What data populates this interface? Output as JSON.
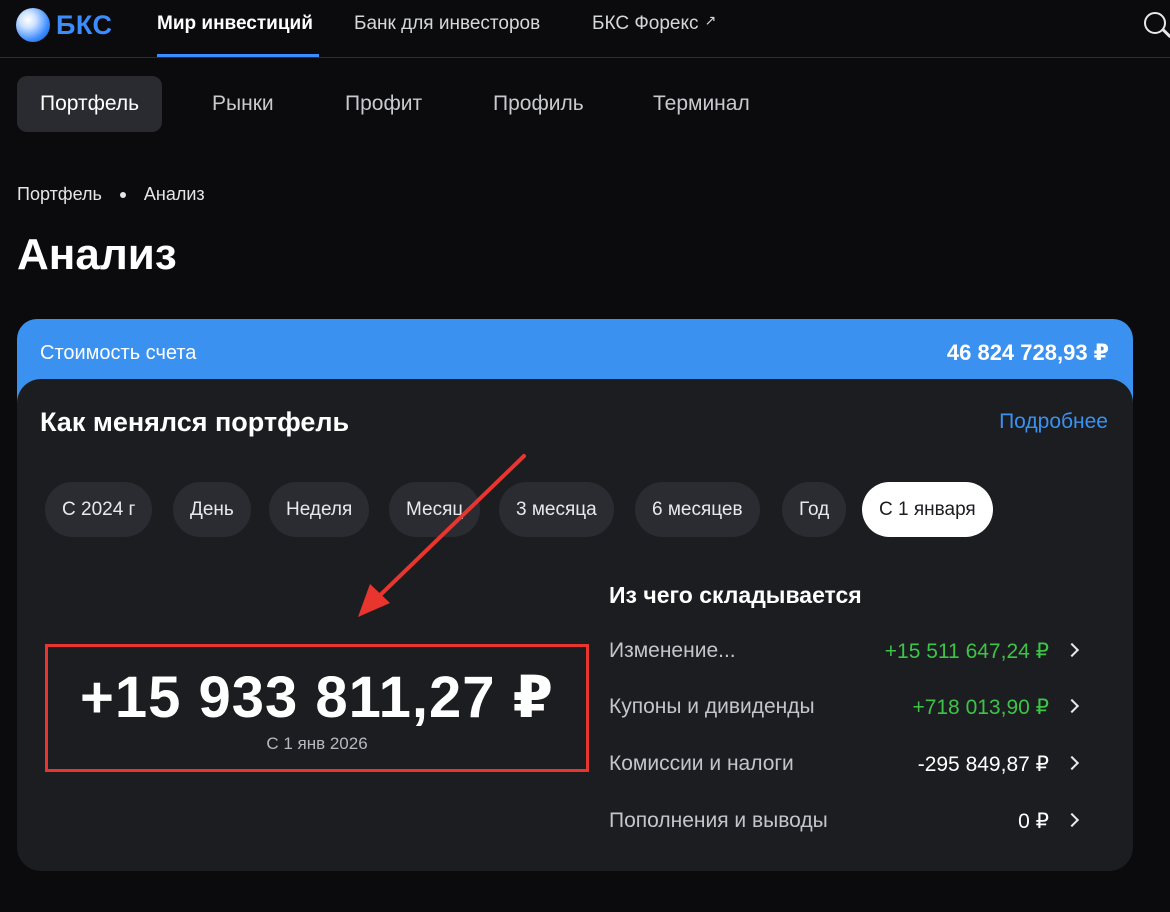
{
  "header": {
    "logo_text": "БКС",
    "nav": [
      "Мир инвестиций",
      "Банк для инвесторов",
      "БКС Форекс"
    ],
    "external_icon": "↗"
  },
  "tabs": [
    "Портфель",
    "Рынки",
    "Профит",
    "Профиль",
    "Терминал"
  ],
  "breadcrumb": [
    "Портфель",
    "Анализ"
  ],
  "page_title": "Анализ",
  "account": {
    "label": "Стоимость счета",
    "value": "46 824 728,93 ₽"
  },
  "panel": {
    "title": "Как менялся портфель",
    "more_link": "Подробнее",
    "periods": [
      "С 2024 г",
      "День",
      "Неделя",
      "Месяц",
      "3 месяца",
      "6 месяцев",
      "Год",
      "С 1 января"
    ],
    "selected_period": "С 1 января",
    "change_value": "+15 933 811,27 ₽",
    "change_since": "С 1 янв 2026",
    "breakdown_title": "Из чего складывается",
    "breakdown": [
      {
        "label": "Изменение...",
        "value": "+15 511 647,24 ₽"
      },
      {
        "label": "Купоны и дивиденды",
        "value": "+718 013,90 ₽"
      },
      {
        "label": "Комиссии и налоги",
        "value": "-295 849,87 ₽"
      },
      {
        "label": "Пополнения и выводы",
        "value": "0 ₽"
      }
    ]
  },
  "colors": {
    "accent": "#3a91f0",
    "positive": "#3cc447",
    "highlight": "#e8352e"
  }
}
